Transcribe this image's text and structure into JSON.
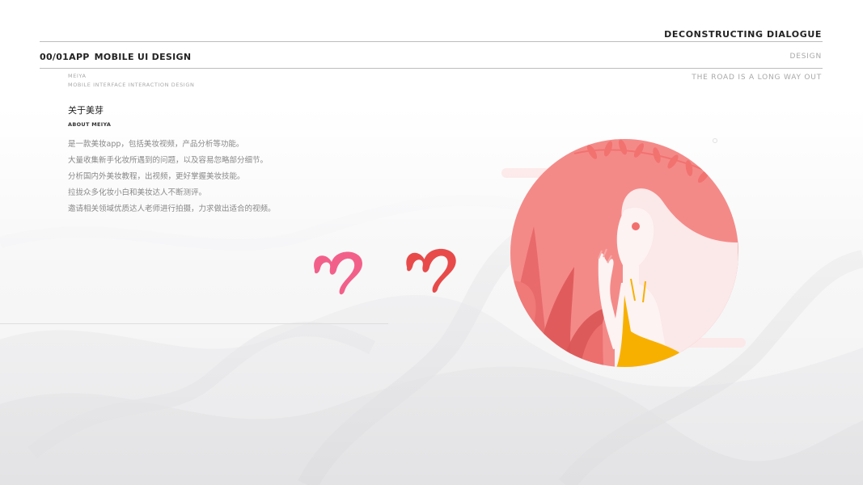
{
  "header": {
    "title": "DECONSTRUCTING DIALOGUE",
    "index": "00/01APP",
    "project": "MOBILE UI DESIGN",
    "category": "DESIGN",
    "slogan": "THE ROAD IS A LONG WAY OUT"
  },
  "brand": {
    "name": "MEIYA",
    "subtitle": "MOBILE INTERFACE INTERACTION DESIGN"
  },
  "about": {
    "title_cn": "关于美芽",
    "title_en": "ABOUT MEIYA",
    "lines": [
      "是一款美妆app，包括美妆视频，产品分析等功能。",
      "大量收集新手化妆所遇到的问题，以及容易忽略部分细节。",
      "分析国内外美妆教程，出视频，更好掌握美妆技能。",
      "拉拢众多化妆小白和美妆达人不断测评。",
      "邀请相关领域优质达人老师进行拍摄，力求做出适合的视频。"
    ]
  },
  "logos": {
    "items": [
      {
        "name": "logo-pink",
        "color": "#f2608a"
      },
      {
        "name": "logo-red",
        "color": "#e84a4a"
      }
    ]
  },
  "illustration": {
    "circle_color": "#f48a88",
    "dress_color": "#f8b000",
    "leaf_color": "#e86a6a"
  }
}
